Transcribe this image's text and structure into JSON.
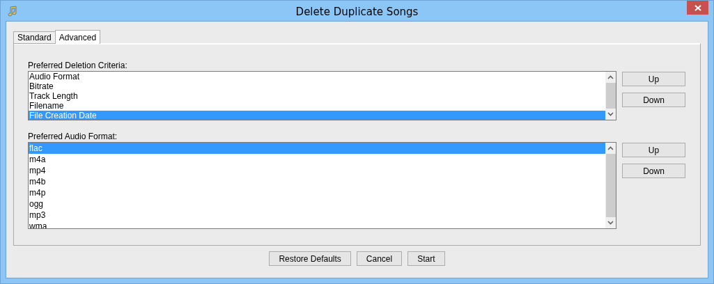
{
  "window": {
    "title": "Delete Duplicate Songs"
  },
  "tabs": [
    {
      "label": "Standard",
      "selected": false
    },
    {
      "label": "Advanced",
      "selected": true
    }
  ],
  "sections": [
    {
      "label": "Preferred Deletion Criteria:",
      "items": [
        {
          "label": "Audio Format",
          "selected": false
        },
        {
          "label": "Bitrate",
          "selected": false
        },
        {
          "label": "Track Length",
          "selected": false
        },
        {
          "label": "Filename",
          "selected": false
        },
        {
          "label": "File Creation Date",
          "selected": true
        }
      ],
      "buttons": [
        "Up",
        "Down"
      ]
    },
    {
      "label": "Preferred Audio Format:",
      "items": [
        {
          "label": "flac",
          "selected": true
        },
        {
          "label": "m4a",
          "selected": false
        },
        {
          "label": "mp4",
          "selected": false
        },
        {
          "label": "m4b",
          "selected": false
        },
        {
          "label": "m4p",
          "selected": false
        },
        {
          "label": "ogg",
          "selected": false
        },
        {
          "label": "mp3",
          "selected": false
        },
        {
          "label": "wma",
          "selected": false
        }
      ],
      "buttons": [
        "Up",
        "Down"
      ]
    }
  ],
  "buttons": [
    "Restore Defaults",
    "Cancel",
    "Start"
  ]
}
